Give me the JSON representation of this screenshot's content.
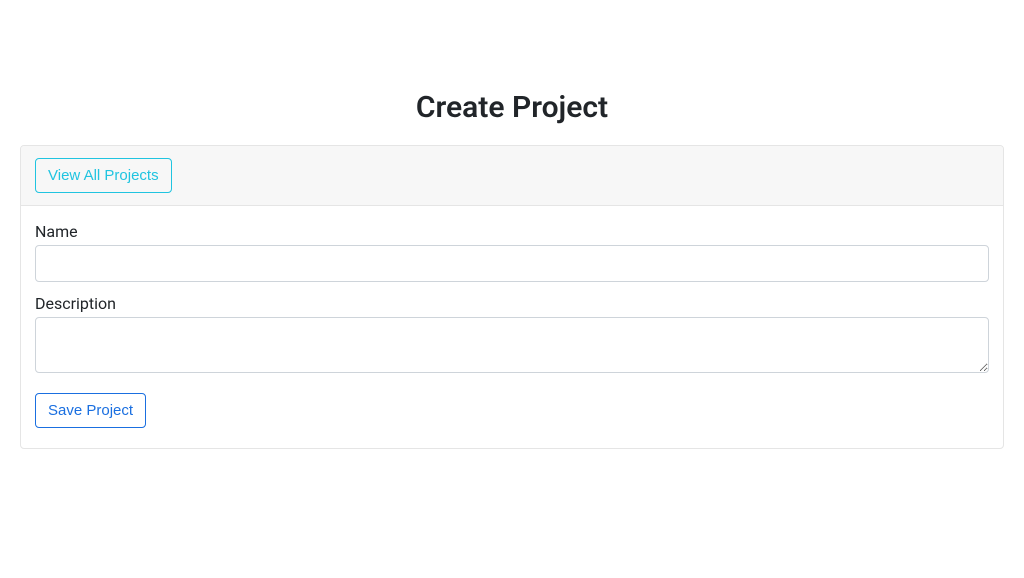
{
  "page": {
    "title": "Create Project"
  },
  "header": {
    "view_all_label": "View All Projects"
  },
  "form": {
    "name_label": "Name",
    "name_value": "",
    "description_label": "Description",
    "description_value": "",
    "save_label": "Save Project"
  }
}
